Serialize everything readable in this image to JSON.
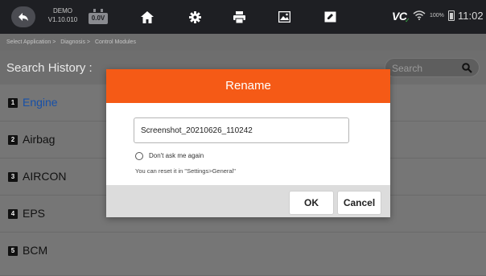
{
  "topbar": {
    "version_line1": "DEMO",
    "version_line2": "V1.10.010",
    "voltage": "0.0V",
    "vci_label": "VC",
    "battery_pct": "100%",
    "time": "11:02",
    "icons": [
      "back-icon",
      "home-icon",
      "settings-icon",
      "print-icon",
      "screenshot-icon",
      "edit-icon",
      "wifi-icon",
      "battery-icon"
    ]
  },
  "breadcrumb": [
    "Select Application >",
    "Diagnosis >",
    "Control Modules"
  ],
  "header": {
    "title": "Search History :",
    "search_placeholder": "Search"
  },
  "list": [
    {
      "num": "1",
      "label": "Engine"
    },
    {
      "num": "2",
      "label": "Airbag"
    },
    {
      "num": "3",
      "label": "AIRCON"
    },
    {
      "num": "4",
      "label": "EPS"
    },
    {
      "num": "5",
      "label": "BCM"
    }
  ],
  "dialog": {
    "title": "Rename",
    "filename": "Screenshot_20210626_110242",
    "checkbox_label": "Don't ask me again",
    "hint": "You can reset it in \"Settings>General\"",
    "ok_label": "OK",
    "cancel_label": "Cancel"
  },
  "colors": {
    "accent": "#f55a16",
    "selected_item": "#1750a8",
    "vci_ok": "#3db54a"
  }
}
